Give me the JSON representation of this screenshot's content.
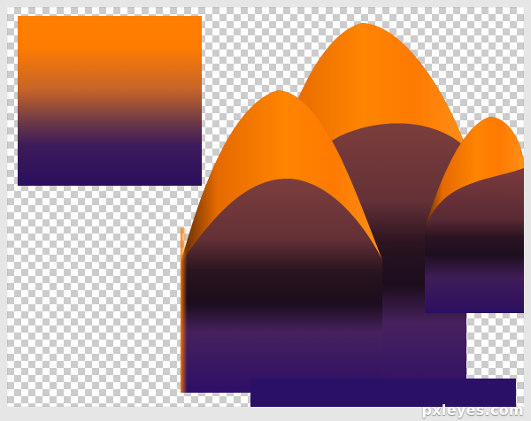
{
  "watermark": {
    "text": "pxleyes.com"
  },
  "colors": {
    "transparent_checker_light": "#ffffff",
    "transparent_checker_dark": "#cccccc",
    "orange": "#ff7f00",
    "purple": "#2a0f5d",
    "deep_shadow": "#21101e"
  }
}
